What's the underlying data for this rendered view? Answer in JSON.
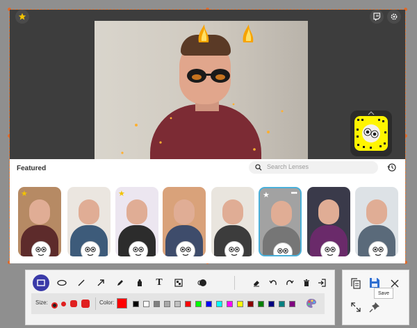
{
  "colors": {
    "selection_border": "#e07a3a",
    "accent_active": "#3a3aa8",
    "selected_lens": "#4ab0d9",
    "current_color": "#ff0000"
  },
  "lenses_panel": {
    "title": "Featured",
    "search_placeholder": "Search Lenses"
  },
  "lenses": [
    {
      "name": "puppy",
      "starred": true,
      "selected": false,
      "bg": "#b68a64",
      "shirt": "#5d2b2b"
    },
    {
      "name": "big-eyes",
      "starred": false,
      "selected": false,
      "bg": "#ebe6e0",
      "shirt": "#3d5b7a"
    },
    {
      "name": "flower-crown",
      "starred": true,
      "selected": false,
      "bg": "#ece6f0",
      "shirt": "#2c2c2c"
    },
    {
      "name": "wood-wall",
      "starred": false,
      "selected": false,
      "bg": "#d9a27a",
      "shirt": "#3e4c6b"
    },
    {
      "name": "cartoon-eyes",
      "starred": false,
      "selected": false,
      "bg": "#e9e5de",
      "shirt": "#3c3c3c"
    },
    {
      "name": "googly-eyes",
      "starred": true,
      "selected": true,
      "bg": "#a2a2a2",
      "shirt": "#767676"
    },
    {
      "name": "kitty-mask",
      "starred": false,
      "selected": false,
      "bg": "#3a3a4a",
      "shirt": "#6a2a6a"
    },
    {
      "name": "mustache",
      "starred": false,
      "selected": false,
      "bg": "#dde2e6",
      "shirt": "#5a6a7a"
    }
  ],
  "toolbar": {
    "tools": [
      {
        "name": "rectangle-tool",
        "active": true
      },
      {
        "name": "ellipse-tool",
        "active": false
      },
      {
        "name": "line-tool",
        "active": false
      },
      {
        "name": "arrow-tool",
        "active": false
      },
      {
        "name": "pen-tool",
        "active": false
      },
      {
        "name": "highlighter-tool",
        "active": false
      },
      {
        "name": "text-tool",
        "active": false
      },
      {
        "name": "mosaic-tool",
        "active": false
      },
      {
        "name": "step-tool",
        "active": false
      },
      {
        "name": "eraser-tool",
        "active": false
      },
      {
        "name": "undo-tool",
        "active": false
      },
      {
        "name": "redo-tool",
        "active": false
      },
      {
        "name": "delete-tool",
        "active": false
      },
      {
        "name": "exit-tool",
        "active": false
      }
    ],
    "text_tool_glyph": "T",
    "size_label": "Size:",
    "color_label": "Color:",
    "palette": [
      "#000000",
      "#ffffff",
      "#808080",
      "#a9a9a9",
      "#c0c0c0",
      "#ff0000",
      "#00ff00",
      "#0000ff",
      "#00ffff",
      "#ff00ff",
      "#ffff00",
      "#8b0000",
      "#008000",
      "#000080",
      "#008080",
      "#800080"
    ]
  },
  "side_panel": {
    "save_tooltip": "Save"
  }
}
